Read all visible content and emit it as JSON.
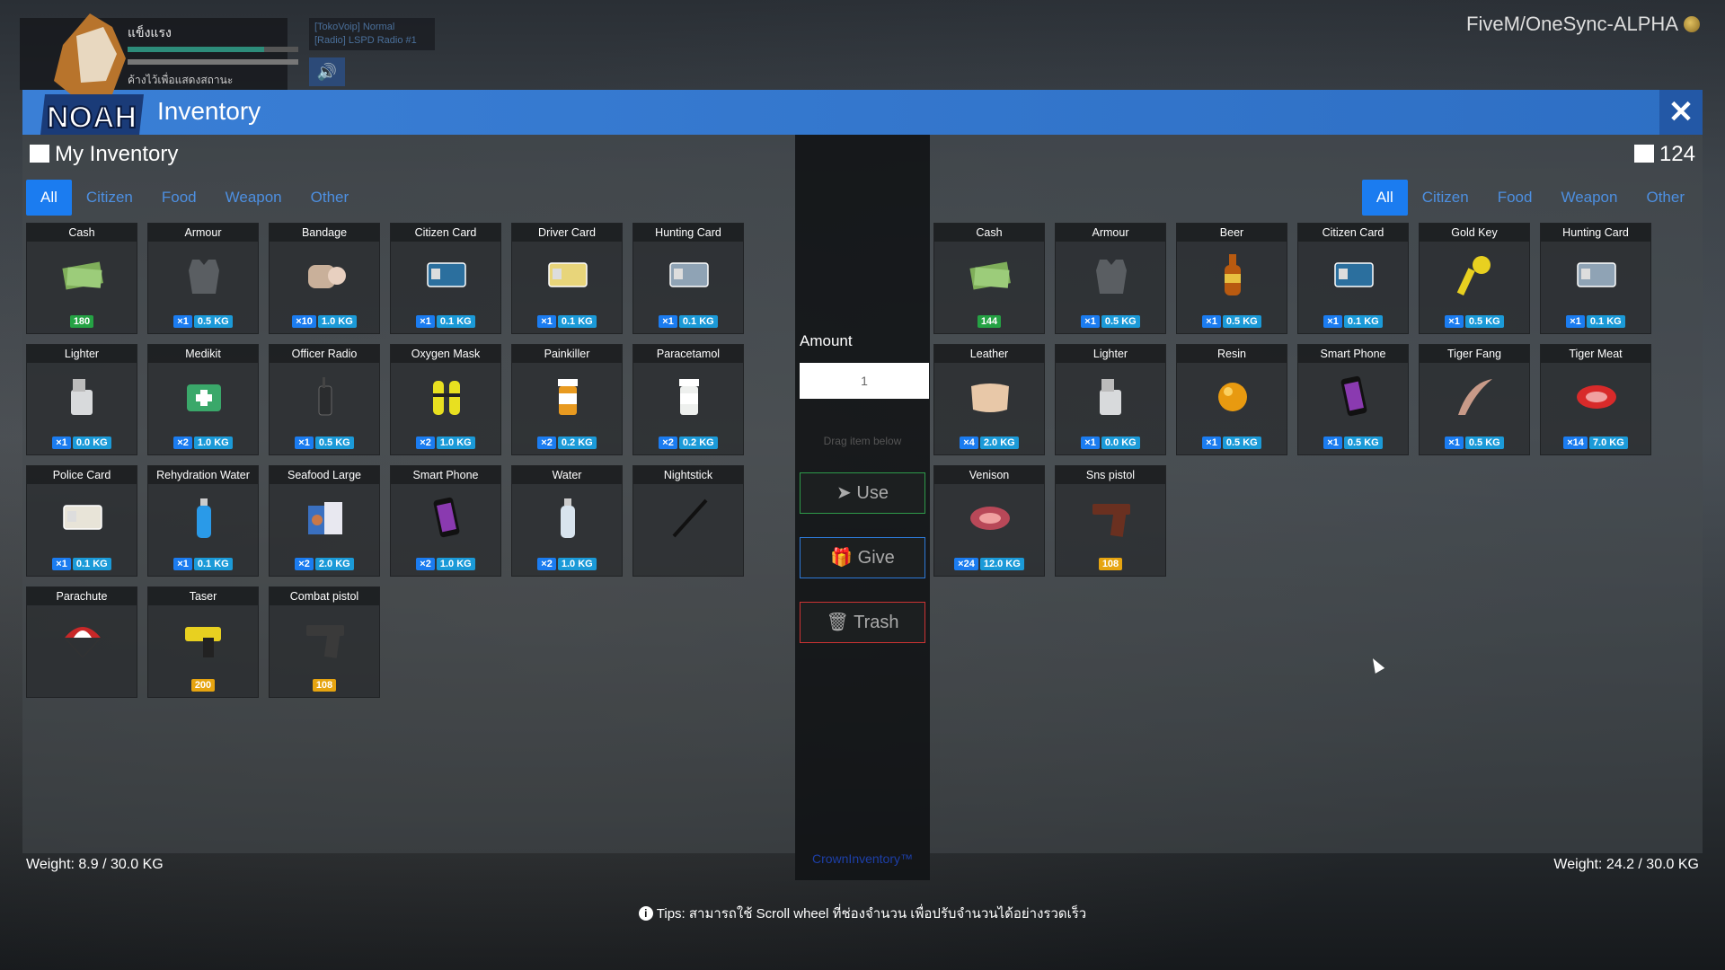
{
  "hud": {
    "player_name": "แข็งแรง",
    "sub_text": "ค้างไว้เพื่อแสดงสถานะ",
    "radio_line1": "[TokoVoip] Normal",
    "radio_line2": "[Radio] LSPD Radio #1"
  },
  "server": {
    "label": "FiveM/OneSync-ALPHA"
  },
  "logo": {
    "text": "NOAH"
  },
  "window": {
    "title": "Inventory",
    "close_icon": "close-icon"
  },
  "left": {
    "title": "My Inventory",
    "tabs": [
      "All",
      "Citizen",
      "Food",
      "Weapon",
      "Other"
    ],
    "weight": "Weight: 8.9 / 30.0 KG",
    "items": [
      {
        "name": "Cash",
        "icon": "cash-icon",
        "color": "#7fae5a",
        "badges": [
          {
            "t": "c",
            "v": "180"
          }
        ]
      },
      {
        "name": "Armour",
        "icon": "armour-icon",
        "color": "#5a5e62",
        "badges": [
          {
            "t": "q",
            "v": "×1"
          },
          {
            "t": "w",
            "v": "0.5 KG"
          }
        ]
      },
      {
        "name": "Bandage",
        "icon": "bandage-icon",
        "color": "#c9b09a",
        "badges": [
          {
            "t": "q",
            "v": "×10"
          },
          {
            "t": "w",
            "v": "1.0 KG"
          }
        ]
      },
      {
        "name": "Citizen Card",
        "icon": "card-icon",
        "color": "#2b6f9e",
        "badges": [
          {
            "t": "q",
            "v": "×1"
          },
          {
            "t": "w",
            "v": "0.1 KG"
          }
        ]
      },
      {
        "name": "Driver Card",
        "icon": "card-icon",
        "color": "#e8d57a",
        "badges": [
          {
            "t": "q",
            "v": "×1"
          },
          {
            "t": "w",
            "v": "0.1 KG"
          }
        ]
      },
      {
        "name": "Hunting Card",
        "icon": "card-icon",
        "color": "#8fa3b5",
        "badges": [
          {
            "t": "q",
            "v": "×1"
          },
          {
            "t": "w",
            "v": "0.1 KG"
          }
        ]
      },
      {
        "name": "Lighter",
        "icon": "lighter-icon",
        "color": "#d8dadc",
        "badges": [
          {
            "t": "q",
            "v": "×1"
          },
          {
            "t": "w",
            "v": "0.0 KG"
          }
        ]
      },
      {
        "name": "Medikit",
        "icon": "medikit-icon",
        "color": "#3aa86a",
        "badges": [
          {
            "t": "q",
            "v": "×2"
          },
          {
            "t": "w",
            "v": "1.0 KG"
          }
        ]
      },
      {
        "name": "Officer Radio",
        "icon": "radio-icon",
        "color": "#2a2c2e",
        "badges": [
          {
            "t": "q",
            "v": "×1"
          },
          {
            "t": "w",
            "v": "0.5 KG"
          }
        ]
      },
      {
        "name": "Oxygen Mask",
        "icon": "oxygen-icon",
        "color": "#e8e020",
        "badges": [
          {
            "t": "q",
            "v": "×2"
          },
          {
            "t": "w",
            "v": "1.0 KG"
          }
        ]
      },
      {
        "name": "Painkiller",
        "icon": "pill-bottle-icon",
        "color": "#e89a20",
        "badges": [
          {
            "t": "q",
            "v": "×2"
          },
          {
            "t": "w",
            "v": "0.2 KG"
          }
        ]
      },
      {
        "name": "Paracetamol",
        "icon": "pill-bottle-icon",
        "color": "#eef0ee",
        "badges": [
          {
            "t": "q",
            "v": "×2"
          },
          {
            "t": "w",
            "v": "0.2 KG"
          }
        ]
      },
      {
        "name": "Police Card",
        "icon": "card-icon",
        "color": "#e8e4d8",
        "badges": [
          {
            "t": "q",
            "v": "×1"
          },
          {
            "t": "w",
            "v": "0.1 KG"
          }
        ]
      },
      {
        "name": "Rehydration Water",
        "icon": "bottle-icon",
        "color": "#2a9ae8",
        "badges": [
          {
            "t": "q",
            "v": "×1"
          },
          {
            "t": "w",
            "v": "0.1 KG"
          }
        ]
      },
      {
        "name": "Seafood Large",
        "icon": "food-box-icon",
        "color": "#3a70c0",
        "badges": [
          {
            "t": "q",
            "v": "×2"
          },
          {
            "t": "w",
            "v": "2.0 KG"
          }
        ]
      },
      {
        "name": "Smart Phone",
        "icon": "phone-icon",
        "color": "#8a3ab0",
        "badges": [
          {
            "t": "q",
            "v": "×2"
          },
          {
            "t": "w",
            "v": "1.0 KG"
          }
        ]
      },
      {
        "name": "Water",
        "icon": "bottle-icon",
        "color": "#d8e4ee",
        "badges": [
          {
            "t": "q",
            "v": "×2"
          },
          {
            "t": "w",
            "v": "1.0 KG"
          }
        ]
      },
      {
        "name": "Nightstick",
        "icon": "nightstick-icon",
        "color": "#222",
        "badges": []
      },
      {
        "name": "Parachute",
        "icon": "parachute-icon",
        "color": "#c82828",
        "badges": []
      },
      {
        "name": "Taser",
        "icon": "taser-icon",
        "color": "#e8d020",
        "badges": [
          {
            "t": "a",
            "v": "200"
          }
        ]
      },
      {
        "name": "Combat pistol",
        "icon": "pistol-icon",
        "color": "#3a3a3a",
        "badges": [
          {
            "t": "a",
            "v": "108"
          }
        ]
      }
    ]
  },
  "center": {
    "amount_label": "Amount",
    "amount_value": "1",
    "drag_hint": "Drag item below",
    "use": "Use",
    "give": "Give",
    "trash": "Trash",
    "brand": "CrownInventory™"
  },
  "right": {
    "count": "124",
    "tabs": [
      "All",
      "Citizen",
      "Food",
      "Weapon",
      "Other"
    ],
    "weight": "Weight: 24.2 / 30.0 KG",
    "items": [
      {
        "name": "Cash",
        "icon": "cash-icon",
        "color": "#7fae5a",
        "badges": [
          {
            "t": "c",
            "v": "144"
          }
        ]
      },
      {
        "name": "Armour",
        "icon": "armour-icon",
        "color": "#5a5e62",
        "badges": [
          {
            "t": "q",
            "v": "×1"
          },
          {
            "t": "w",
            "v": "0.5 KG"
          }
        ]
      },
      {
        "name": "Beer",
        "icon": "beer-icon",
        "color": "#b85a10",
        "badges": [
          {
            "t": "q",
            "v": "×1"
          },
          {
            "t": "w",
            "v": "0.5 KG"
          }
        ]
      },
      {
        "name": "Citizen Card",
        "icon": "card-icon",
        "color": "#2b6f9e",
        "badges": [
          {
            "t": "q",
            "v": "×1"
          },
          {
            "t": "w",
            "v": "0.1 KG"
          }
        ]
      },
      {
        "name": "Gold Key",
        "icon": "key-icon",
        "color": "#e8d020",
        "badges": [
          {
            "t": "q",
            "v": "×1"
          },
          {
            "t": "w",
            "v": "0.5 KG"
          }
        ]
      },
      {
        "name": "Hunting Card",
        "icon": "card-icon",
        "color": "#8fa3b5",
        "badges": [
          {
            "t": "q",
            "v": "×1"
          },
          {
            "t": "w",
            "v": "0.1 KG"
          }
        ]
      },
      {
        "name": "Leather",
        "icon": "leather-icon",
        "color": "#e8c8a8",
        "badges": [
          {
            "t": "q",
            "v": "×4"
          },
          {
            "t": "w",
            "v": "2.0 KG"
          }
        ]
      },
      {
        "name": "Lighter",
        "icon": "lighter-icon",
        "color": "#d8dadc",
        "badges": [
          {
            "t": "q",
            "v": "×1"
          },
          {
            "t": "w",
            "v": "0.0 KG"
          }
        ]
      },
      {
        "name": "Resin",
        "icon": "resin-icon",
        "color": "#e89a10",
        "badges": [
          {
            "t": "q",
            "v": "×1"
          },
          {
            "t": "w",
            "v": "0.5 KG"
          }
        ]
      },
      {
        "name": "Smart Phone",
        "icon": "phone-icon",
        "color": "#8a3ab0",
        "badges": [
          {
            "t": "q",
            "v": "×1"
          },
          {
            "t": "w",
            "v": "0.5 KG"
          }
        ]
      },
      {
        "name": "Tiger Fang",
        "icon": "fang-icon",
        "color": "#c89a88",
        "badges": [
          {
            "t": "q",
            "v": "×1"
          },
          {
            "t": "w",
            "v": "0.5 KG"
          }
        ]
      },
      {
        "name": "Tiger Meat",
        "icon": "meat-icon",
        "color": "#d82a2a",
        "badges": [
          {
            "t": "q",
            "v": "×14"
          },
          {
            "t": "w",
            "v": "7.0 KG"
          }
        ]
      },
      {
        "name": "Venison",
        "icon": "meat-icon",
        "color": "#b84858",
        "badges": [
          {
            "t": "q",
            "v": "×24"
          },
          {
            "t": "w",
            "v": "12.0 KG"
          }
        ]
      },
      {
        "name": "Sns pistol",
        "icon": "pistol-icon",
        "color": "#6a3020",
        "badges": [
          {
            "t": "a",
            "v": "108"
          }
        ]
      }
    ]
  },
  "tips": "Tips: สามารถใช้ Scroll wheel ที่ช่องจำนวน เพื่อปรับจำนวนได้อย่างรวดเร็ว"
}
